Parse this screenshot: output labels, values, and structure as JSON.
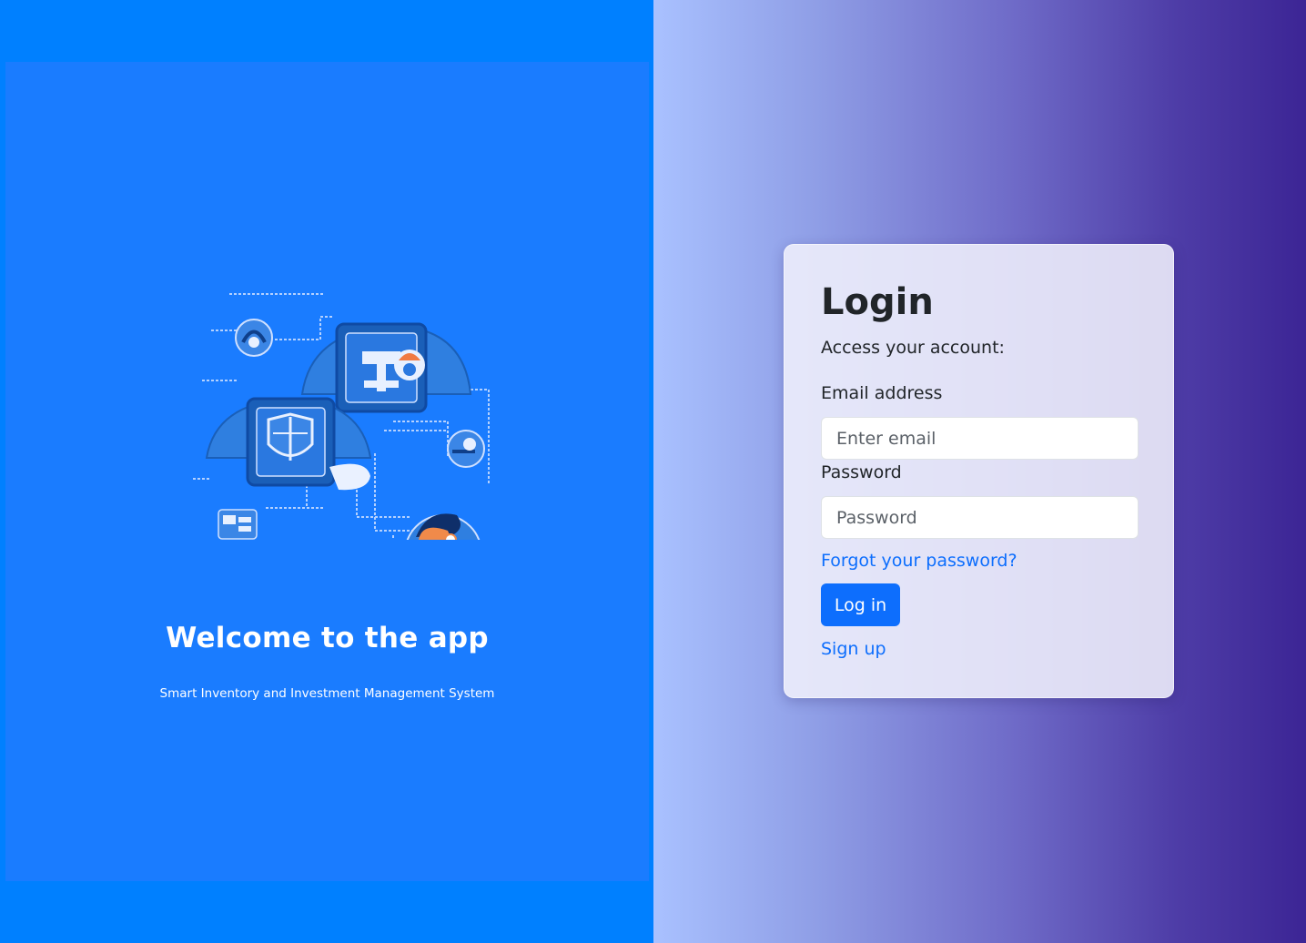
{
  "welcome": {
    "title": "Welcome to the app",
    "tagline": "Smart Inventory and Investment Management System",
    "illustration_icon": "security-network-illustration"
  },
  "login": {
    "title": "Login",
    "subtitle": "Access your account:",
    "email_label": "Email address",
    "email_placeholder": "Enter email",
    "email_value": "",
    "password_label": "Password",
    "password_placeholder": "Password",
    "password_value": "",
    "forgot_link": "Forgot your password?",
    "submit_label": "Log in",
    "signup_link": "Sign up"
  },
  "colors": {
    "left_background": "#0080ff",
    "left_panel": "#1a7cff",
    "primary": "#0d6efd",
    "gradient_start": "#a9c1ff",
    "gradient_end": "#3c2595"
  }
}
